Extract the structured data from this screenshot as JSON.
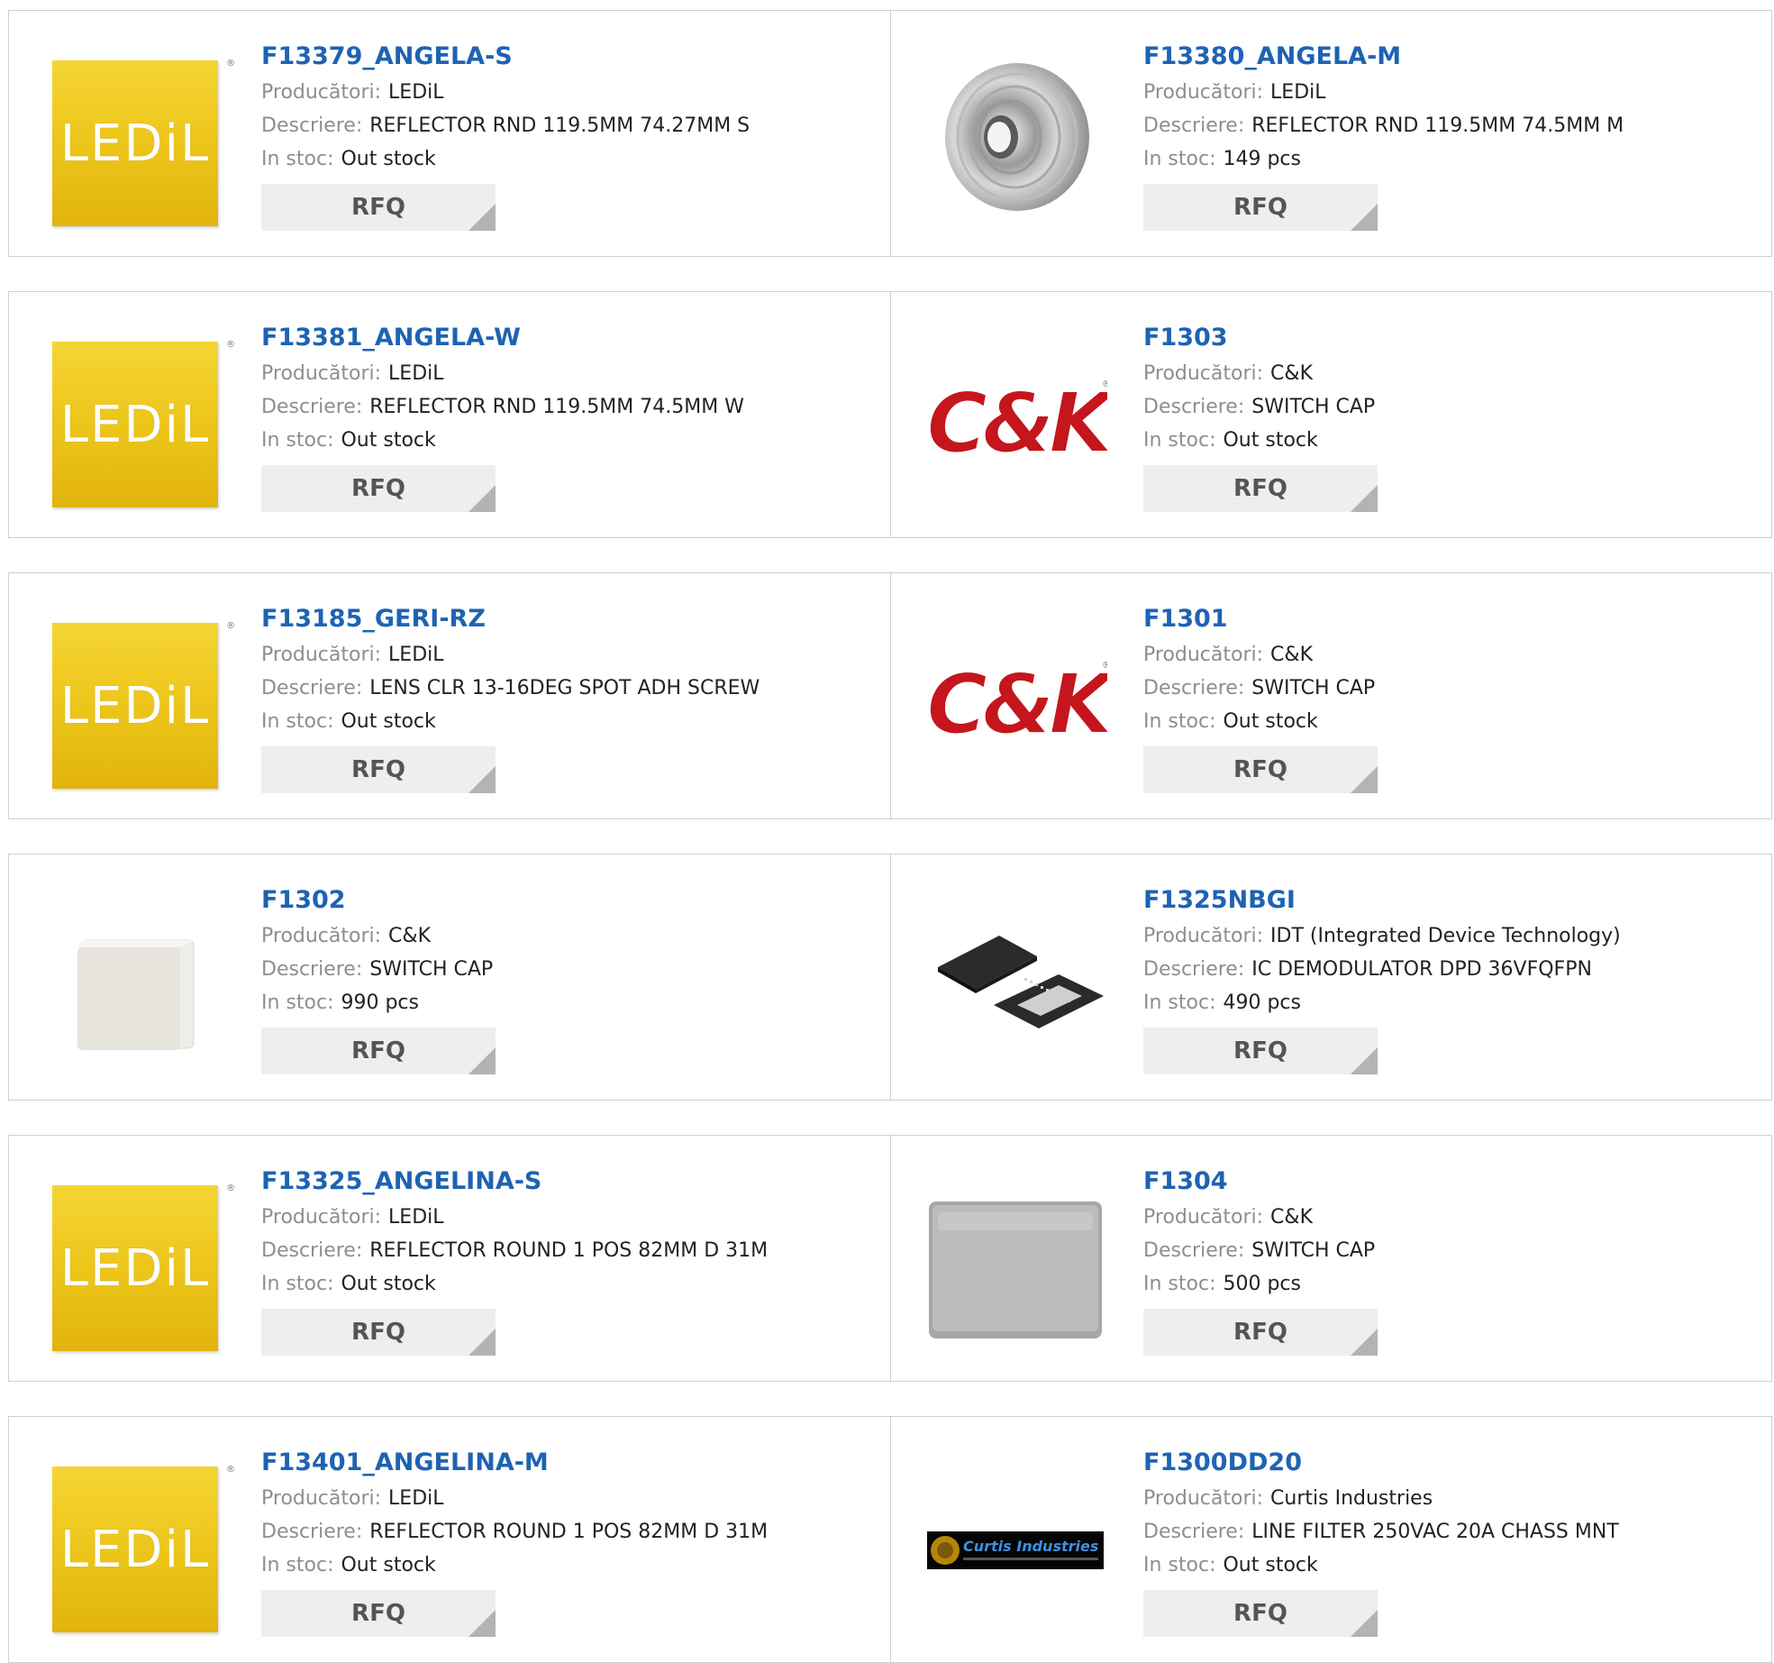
{
  "labels": {
    "manufacturer": "Producători:",
    "description": "Descriere:",
    "stock": "In stoc:",
    "rfq": "RFQ"
  },
  "colors": {
    "link": "#1e63b3",
    "button_bg": "#eeeeee",
    "ledil_yellow": "#ecc418",
    "ck_red": "#c4161c"
  },
  "products": [
    {
      "part": "F13379_ANGELA-S",
      "manufacturer": "LEDiL",
      "description": "REFLECTOR RND 119.5MM 74.27MM S",
      "stock": "Out stock",
      "image": "ledil-logo"
    },
    {
      "part": "F13380_ANGELA-M",
      "manufacturer": "LEDiL",
      "description": "REFLECTOR RND 119.5MM 74.5MM M",
      "stock": "149 pcs",
      "image": "reflector-photo"
    },
    {
      "part": "F13381_ANGELA-W",
      "manufacturer": "LEDiL",
      "description": "REFLECTOR RND 119.5MM 74.5MM W",
      "stock": "Out stock",
      "image": "ledil-logo"
    },
    {
      "part": "F1303",
      "manufacturer": "C&K",
      "description": "SWITCH CAP",
      "stock": "Out stock",
      "image": "ck-logo"
    },
    {
      "part": "F13185_GERI-RZ",
      "manufacturer": "LEDiL",
      "description": "LENS CLR 13-16DEG SPOT ADH SCREW",
      "stock": "Out stock",
      "image": "ledil-logo"
    },
    {
      "part": "F1301",
      "manufacturer": "C&K",
      "description": "SWITCH CAP",
      "stock": "Out stock",
      "image": "ck-logo"
    },
    {
      "part": "F1302",
      "manufacturer": "C&K",
      "description": "SWITCH CAP",
      "stock": "990 pcs",
      "image": "white-cap-photo"
    },
    {
      "part": "F1325NBGI",
      "manufacturer": "IDT (Integrated Device Technology)",
      "description": "IC DEMODULATOR DPD 36VFQFPN",
      "stock": "490 pcs",
      "image": "qfn-chip-photo"
    },
    {
      "part": "F13325_ANGELINA-S",
      "manufacturer": "LEDiL",
      "description": "REFLECTOR ROUND 1 POS 82MM D 31M",
      "stock": "Out stock",
      "image": "ledil-logo"
    },
    {
      "part": "F1304",
      "manufacturer": "C&K",
      "description": "SWITCH CAP",
      "stock": "500 pcs",
      "image": "grey-cap-photo"
    },
    {
      "part": "F13401_ANGELINA-M",
      "manufacturer": "LEDiL",
      "description": "REFLECTOR ROUND 1 POS 82MM D 31M",
      "stock": "Out stock",
      "image": "ledil-logo"
    },
    {
      "part": "F1300DD20",
      "manufacturer": "Curtis Industries",
      "description": "LINE FILTER 250VAC 20A CHASS MNT",
      "stock": "Out stock",
      "image": "curtis-logo"
    }
  ]
}
